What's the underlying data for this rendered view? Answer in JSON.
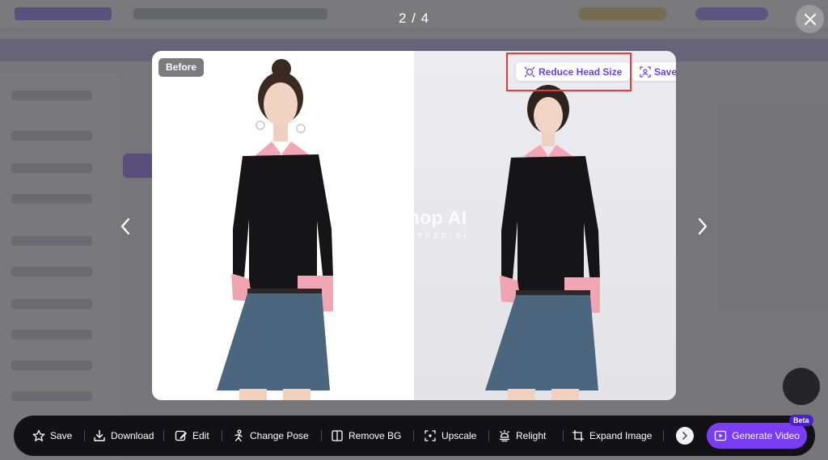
{
  "viewer": {
    "counter": "2 / 4",
    "before_label": "Before",
    "reduce_head_label": "Reduce Head Size",
    "save_model_label": "Save as your own AI model",
    "watermark_logo": "WeShop AI",
    "watermark_url": "www.weshop.ai"
  },
  "toolbar": {
    "save": "Save",
    "download": "Download",
    "edit": "Edit",
    "change_pose": "Change Pose",
    "remove_bg": "Remove BG",
    "upscale": "Upscale",
    "relight": "Relight",
    "expand_image": "Expand Image",
    "generate_video": "Generate Video",
    "beta": "Beta"
  },
  "colors": {
    "accent": "#7a3df5",
    "chip_text": "#6d3df0",
    "highlight": "#e53d3d",
    "toolbar_bg": "#121216"
  }
}
